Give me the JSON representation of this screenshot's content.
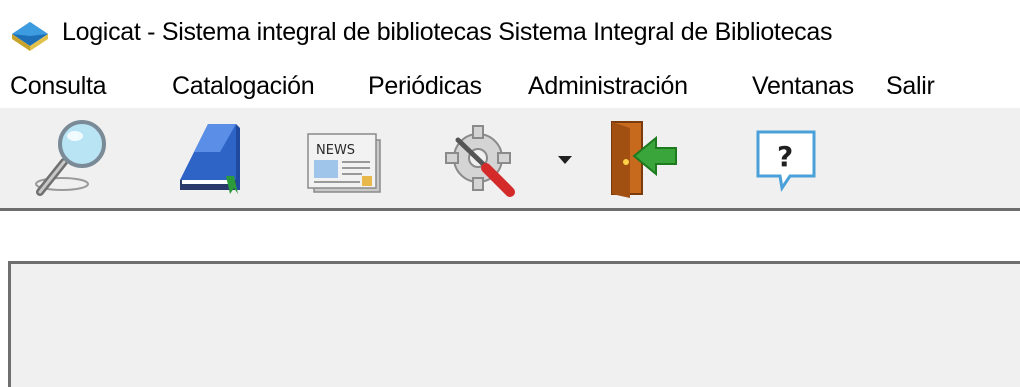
{
  "window": {
    "title": "Logicat - Sistema integral de bibliotecas Sistema Integral de Bibliotecas",
    "icon": "book-diamond-icon"
  },
  "menu": [
    {
      "label": "Consulta"
    },
    {
      "label": "Catalogación"
    },
    {
      "label": "Periódicas"
    },
    {
      "label": "Administración"
    },
    {
      "label": "Ventanas"
    },
    {
      "label": "Salir"
    }
  ],
  "toolbar": [
    {
      "icon": "magnifier-icon"
    },
    {
      "icon": "catalog-book-icon"
    },
    {
      "icon": "newspaper-icon"
    },
    {
      "icon": "settings-tools-icon"
    },
    {
      "icon": "dropdown-arrow-icon"
    },
    {
      "icon": "exit-door-icon"
    },
    {
      "icon": "help-icon"
    }
  ],
  "colors": {
    "toolbar_bg": "#f0f0f0",
    "workspace_bg": "#f0f0f0",
    "separator": "#6d6d6d",
    "exit_arrow": "#3aa53a",
    "help_accent": "#4aa0d8"
  }
}
